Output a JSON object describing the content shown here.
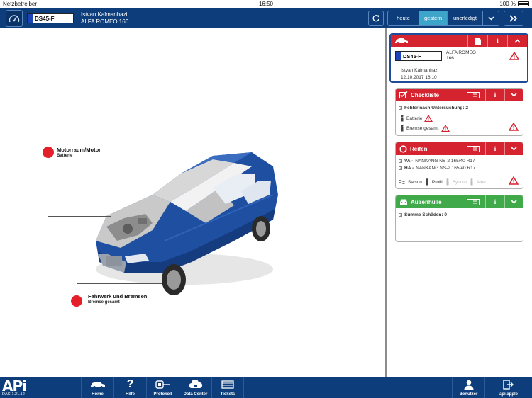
{
  "status": {
    "carrier": "Netzbetreiber",
    "time": "16:50",
    "battery": "100 %"
  },
  "header": {
    "plate": "DS45-F",
    "owner": "Istvan Kalmanhazi",
    "vehicle": "ALFA ROMEO 166",
    "tabs": [
      "heute",
      "gestern",
      "unerledigt"
    ],
    "active_tab": "gestern"
  },
  "diagram": {
    "markers": [
      {
        "title": "Motorraum/Motor",
        "sub": "Batterie"
      },
      {
        "title": "Fahrwerk und Bremsen",
        "sub": "Bremse gesamt"
      }
    ]
  },
  "vehicle_card": {
    "plate": "DS45-F",
    "model_line1": "ALFA ROMEO",
    "model_line2": "166",
    "owner": "Istvan Kalmanhazi",
    "date": "12.10.2017 16:10"
  },
  "checkliste": {
    "title": "Checkliste",
    "summary": "Fehler nach Untersuchung: 2",
    "items": [
      "Batterie",
      "Bremse gesamt"
    ]
  },
  "reifen": {
    "title": "Reifen",
    "va_label": "VA -",
    "va_value": "NANKANG NS-2 165/40 R17",
    "ha_label": "HA -",
    "ha_value": "NANKANG NS-2 165/40 R17",
    "attrs": [
      "Saison",
      "Profil",
      "Syncro",
      "Alter"
    ]
  },
  "aussen": {
    "title": "Außenhülle",
    "summary": "Summe Schäden: 0"
  },
  "nav": {
    "logo": "APi",
    "version": "DAC-1.21.12",
    "items": [
      "Home",
      "Hilfe",
      "Protokoll",
      "Data Center",
      "Tickets"
    ],
    "user": "Benutzer",
    "logout": "api.apple"
  },
  "colors": {
    "header_bg": "#0d3d7a",
    "alert_red": "#d62330",
    "ok_green": "#40a94a",
    "active_tab": "#3da5c9",
    "car_blue": "#1f4fa0"
  }
}
